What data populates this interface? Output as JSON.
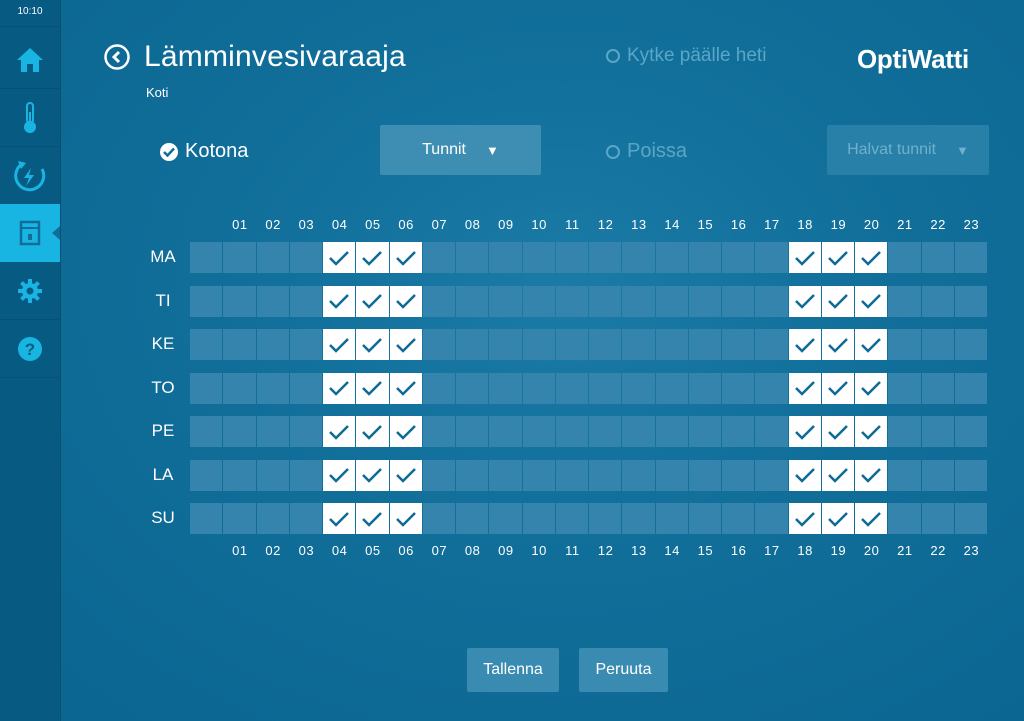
{
  "status_bar": {
    "time": "10:10"
  },
  "sidebar": {
    "items": [
      {
        "name": "home",
        "icon": "home-icon",
        "active": false
      },
      {
        "name": "temperature",
        "icon": "thermometer-icon",
        "active": false
      },
      {
        "name": "energy",
        "icon": "energy-icon",
        "active": false
      },
      {
        "name": "water-heater",
        "icon": "water-heater-icon",
        "active": true
      },
      {
        "name": "settings",
        "icon": "gear-icon",
        "active": false
      },
      {
        "name": "help",
        "icon": "help-icon",
        "active": false
      }
    ]
  },
  "header": {
    "title": "Lämminvesivaraaja",
    "subtitle": "Koti",
    "switch_on_now": "Kytke päälle heti",
    "logo": "OptiWatti"
  },
  "modes": {
    "home": {
      "label": "Kotona",
      "checked": true,
      "dropdown": "Tunnit"
    },
    "away": {
      "label": "Poissa",
      "checked": false,
      "dropdown": "Halvat tunnit"
    }
  },
  "schedule": {
    "hours": [
      "01",
      "02",
      "03",
      "04",
      "05",
      "06",
      "07",
      "08",
      "09",
      "10",
      "11",
      "12",
      "13",
      "14",
      "15",
      "16",
      "17",
      "18",
      "19",
      "20",
      "21",
      "22",
      "23"
    ],
    "days": [
      {
        "label": "MA",
        "active": [
          4,
          5,
          6,
          18,
          19,
          20
        ]
      },
      {
        "label": "TI",
        "active": [
          4,
          5,
          6,
          18,
          19,
          20
        ]
      },
      {
        "label": "KE",
        "active": [
          4,
          5,
          6,
          18,
          19,
          20
        ]
      },
      {
        "label": "TO",
        "active": [
          4,
          5,
          6,
          18,
          19,
          20
        ]
      },
      {
        "label": "PE",
        "active": [
          4,
          5,
          6,
          18,
          19,
          20
        ]
      },
      {
        "label": "LA",
        "active": [
          4,
          5,
          6,
          18,
          19,
          20
        ]
      },
      {
        "label": "SU",
        "active": [
          4,
          5,
          6,
          18,
          19,
          20
        ]
      }
    ]
  },
  "actions": {
    "save": "Tallenna",
    "cancel": "Peruuta"
  },
  "colors": {
    "accent": "#19b5e2",
    "background": "#106e99",
    "cell": "#3584ad",
    "cell_on": "#ffffff",
    "check": "#0e6b95"
  }
}
